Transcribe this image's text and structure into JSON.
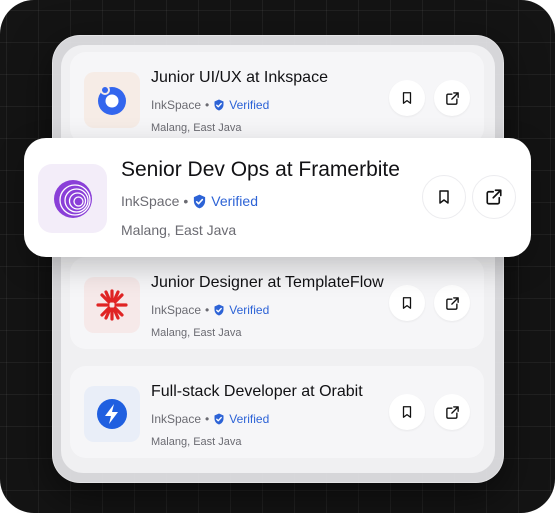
{
  "colors": {
    "background": "#141414",
    "verified": "#2d63d6",
    "inkspace_logo": "#3366ee",
    "framerbite_logo": "#8a3fd8",
    "templateflow_logo": "#e02424",
    "orabit_logo": "#1f5fe0"
  },
  "jobs": [
    {
      "title": "Junior UI/UX at Inkspace",
      "company": "InkSpace",
      "separator": "•",
      "verified_label": "Verified",
      "location": "Malang, East Java",
      "logo_icon": "inkspace-logo-icon",
      "logo_bg": "#f6ece6"
    },
    {
      "title": "Senior Dev Ops at Framerbite",
      "company": "InkSpace",
      "separator": "•",
      "verified_label": "Verified",
      "location": "Malang, East Java",
      "logo_icon": "framerbite-logo-icon",
      "logo_bg": "#f3edf9"
    },
    {
      "title": "Junior Designer at TemplateFlow",
      "company": "InkSpace",
      "separator": "•",
      "verified_label": "Verified",
      "location": "Malang, East Java",
      "logo_icon": "templateflow-logo-icon",
      "logo_bg": "#f6e9e9"
    },
    {
      "title": "Full-stack Developer at Orabit",
      "company": "InkSpace",
      "separator": "•",
      "verified_label": "Verified",
      "location": "Malang, East Java",
      "logo_icon": "orabit-logo-icon",
      "logo_bg": "#e9eef8"
    }
  ],
  "actions": {
    "bookmark_icon": "bookmark-icon",
    "open_icon": "external-link-icon"
  }
}
